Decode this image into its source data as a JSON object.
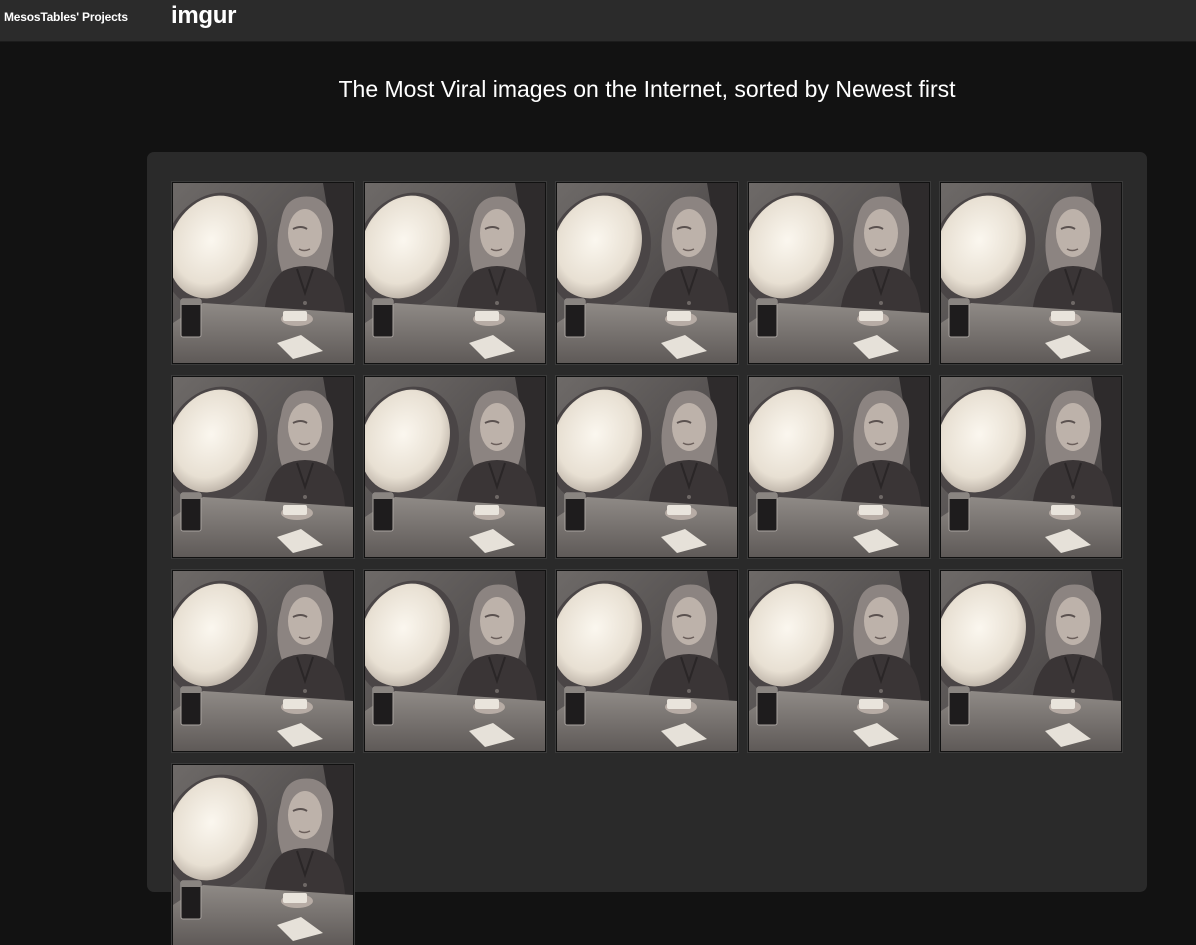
{
  "header": {
    "brand": "MesosTables' Projects",
    "logo": "imgur"
  },
  "headline": "The Most Viral images on the Internet, sorted by Newest first",
  "gallery": {
    "image_count": 16,
    "columns": 5,
    "image_description": "woman-reading-device-on-airplane-photo"
  }
}
